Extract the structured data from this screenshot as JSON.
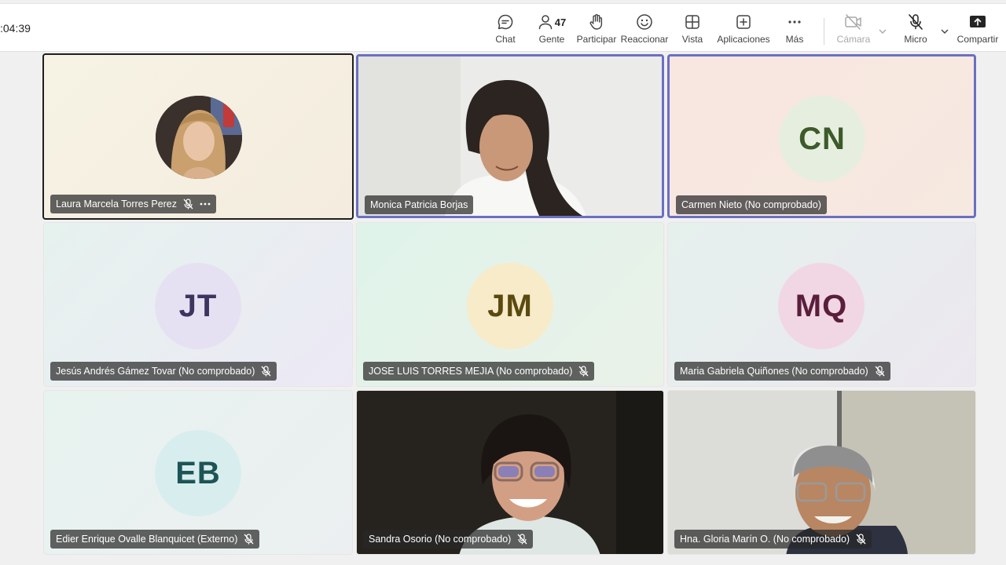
{
  "meeting": {
    "timer": ":04:39"
  },
  "toolbar": {
    "chat": "Chat",
    "people": "Gente",
    "people_count": "47",
    "raise_hand": "Participar",
    "react": "Reaccionar",
    "view": "Vista",
    "apps": "Aplicaciones",
    "more": "Más",
    "camera": "Cámara",
    "mic": "Micro",
    "share": "Compartir"
  },
  "participants": [
    {
      "name": "Laura Marcela Torres Perez",
      "initials": "",
      "muted": true,
      "has_more": true,
      "avatar_type": "photo"
    },
    {
      "name": "Monica Patricia Borjas",
      "initials": "",
      "muted": false,
      "avatar_type": "video"
    },
    {
      "name": "Carmen Nieto (No comprobado)",
      "initials": "CN",
      "muted": false,
      "avatar_type": "initials",
      "color": "#3d5a2a",
      "bg": "#e6efdf"
    },
    {
      "name": "Jesús Andrés Gámez Tovar (No comprobado)",
      "initials": "JT",
      "muted": true,
      "avatar_type": "initials",
      "color": "#3d3560",
      "bg": "#e6e1f2"
    },
    {
      "name": "JOSE LUIS TORRES MEJIA (No comprobado)",
      "initials": "JM",
      "muted": true,
      "avatar_type": "initials",
      "color": "#5a4a10",
      "bg": "#f7ebc9"
    },
    {
      "name": "Maria Gabriela Quiñones (No comprobado)",
      "initials": "MQ",
      "muted": true,
      "avatar_type": "initials",
      "color": "#5a1e3c",
      "bg": "#f1d7e3"
    },
    {
      "name": "Edier Enrique Ovalle Blanquicet (Externo)",
      "initials": "EB",
      "muted": true,
      "avatar_type": "initials",
      "color": "#1e5456",
      "bg": "#d8eeee"
    },
    {
      "name": "Sandra Osorio (No comprobado)",
      "initials": "",
      "muted": true,
      "avatar_type": "video"
    },
    {
      "name": "Hna. Gloria Marín O. (No comprobado)",
      "initials": "",
      "muted": true,
      "avatar_type": "video"
    }
  ]
}
